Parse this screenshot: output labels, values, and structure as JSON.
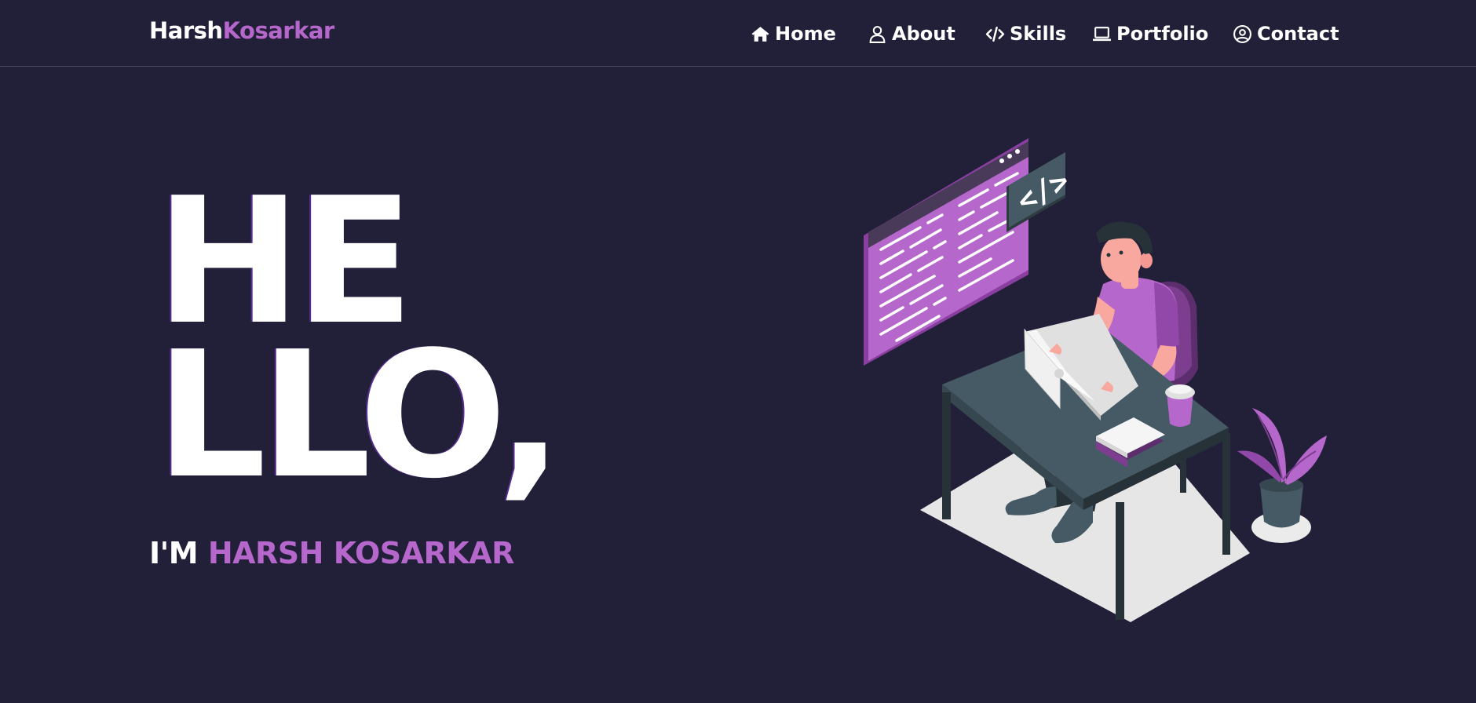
{
  "brand": {
    "first": "Harsh",
    "last": "Kosarkar"
  },
  "nav": {
    "items": [
      {
        "label": "Home",
        "icon": "home-icon"
      },
      {
        "label": "About",
        "icon": "user-icon"
      },
      {
        "label": "Skills",
        "icon": "code-icon"
      },
      {
        "label": "Portfolio",
        "icon": "laptop-icon"
      },
      {
        "label": "Contact",
        "icon": "user-circle-icon"
      }
    ]
  },
  "hero": {
    "line1": "HE",
    "line2": "LLO,",
    "intro": "I'M",
    "name": "HARSH KOSARKAR"
  },
  "colors": {
    "background": "#221f38",
    "accent": "#b667cb",
    "text": "#ffffff"
  },
  "illustration": {
    "code_badge": "</>"
  }
}
